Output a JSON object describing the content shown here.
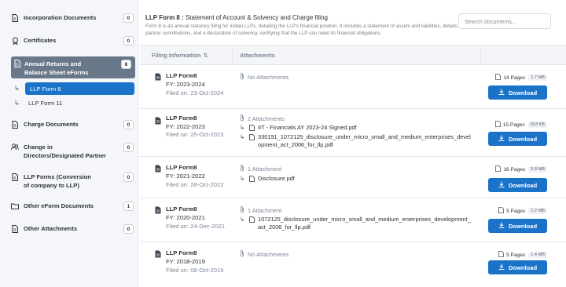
{
  "sidebar": {
    "items": [
      {
        "label": "Incorporation Documents",
        "count": "0",
        "icon": "document-icon"
      },
      {
        "label": "Certificates",
        "count": "0",
        "icon": "certificate-icon"
      },
      {
        "label_line1": "Annual Returns and",
        "label_line2": "Balance Sheet eForms",
        "count": "8",
        "icon": "document-icon"
      },
      {
        "label": "Charge Documents",
        "count": "0",
        "icon": "document-icon"
      },
      {
        "label_line1": "Change in",
        "label_line2": "Directors/Designated Partner",
        "count": "0",
        "icon": "users-icon"
      },
      {
        "label_line1": "LLP Forms (Conversion",
        "label_line2": "of company to LLP)",
        "count": "0",
        "icon": "document-icon"
      },
      {
        "label": "Other eForm Documents",
        "count": "1",
        "icon": "folder-icon"
      },
      {
        "label": "Other Attachments",
        "count": "0",
        "icon": "document-icon"
      }
    ],
    "sub_items": [
      {
        "label": "LLP Form 8",
        "active": true
      },
      {
        "label": "LLP Form 11",
        "active": false
      }
    ]
  },
  "header": {
    "title_bold": "LLP Form 8 :",
    "title_rest": " Statement of Account & Solvency and Charge filing",
    "description": "Form 8 is an annual statutory filing for Indian LLPs, detailing the LLP's financial position. It includes a statement of assets and liabilities, details of partner contributions, and a declaration of solvency, certifying that the LLP can meet its financial obligations.",
    "search_placeholder": "Search documents..."
  },
  "table": {
    "col_filing": "Filing Information",
    "col_filing_sort": "⇅",
    "col_attachments": "Attachments",
    "download_label": "Download",
    "rows": [
      {
        "name": "LLP Form8",
        "fy": "FY: 2023-2024",
        "filed": "Filed on: 23-Oct-2024",
        "att_head": "No Attachments",
        "attachments": [],
        "pages": "14 Pages",
        "size": "1.7 MB"
      },
      {
        "name": "LLP Form8",
        "fy": "FY: 2022-2023",
        "filed": "Filed on: 25-Oct-2023",
        "att_head": "2 Attachments",
        "attachments": [
          "IIT - Financials AY 2023-24 Signed.pdf",
          "330191_1072125_disclosure_under_micro_small_and_medium_enterprises_development_act_2006_for_llp.pdf"
        ],
        "pages": "15 Pages",
        "size": "653 KB"
      },
      {
        "name": "LLP Form8",
        "fy": "FY: 2021-2022",
        "filed": "Filed on: 28-Oct-2022",
        "att_head": "1 Attachment",
        "attachments": [
          "Disclosure.pdf"
        ],
        "pages": "16 Pages",
        "size": "5.8 MB"
      },
      {
        "name": "LLP Form8",
        "fy": "FY: 2020-2021",
        "filed": "Filed on: 24-Dec-2021",
        "att_head": "1 Attachment",
        "attachments": [
          "1072125_disclosure_under_micro_small_and_medium_enterprises_development_act_2006_for_llp.pdf"
        ],
        "pages": "5 Pages",
        "size": "1.2 MB"
      },
      {
        "name": "LLP Form8",
        "fy": "FY: 2018-2019",
        "filed": "Filed on: 08-Oct-2019",
        "att_head": "No Attachments",
        "attachments": [],
        "pages": "5 Pages",
        "size": "1.4 MB"
      }
    ]
  },
  "colors": {
    "accent": "#1a73c9",
    "active_sidebar": "#697889",
    "sidebar_bg": "#f4f6f9"
  }
}
